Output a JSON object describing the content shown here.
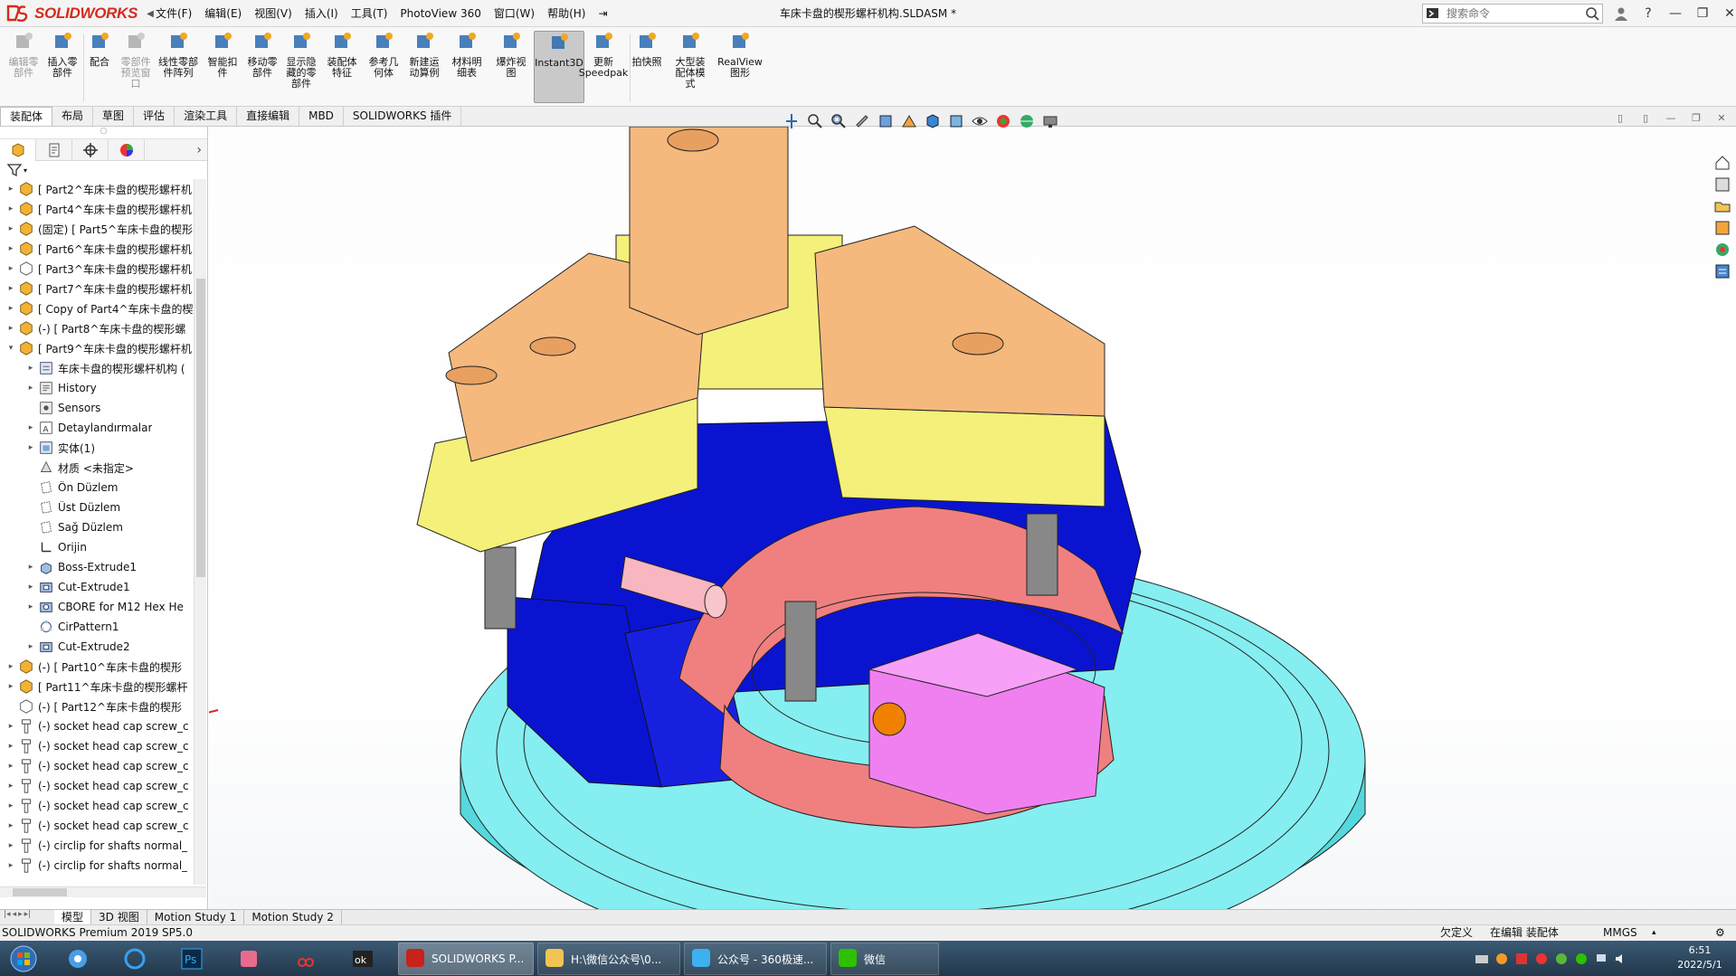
{
  "app": {
    "brand": "SOLIDWORKS",
    "document_title": "车床卡盘的楔形螺杆机构.SLDASM *",
    "menus": [
      "文件(F)",
      "编辑(E)",
      "视图(V)",
      "插入(I)",
      "工具(T)",
      "PhotoView 360",
      "窗口(W)",
      "帮助(H)"
    ],
    "search_placeholder": "搜索命令",
    "help_label": "?"
  },
  "ribbon": [
    {
      "label": "编辑零\n部件",
      "icon": "edit-component-icon",
      "disabled": true
    },
    {
      "label": "插入零\n部件",
      "icon": "insert-component-icon",
      "disabled": false
    },
    {
      "label": "配合",
      "icon": "mate-icon",
      "disabled": false
    },
    {
      "label": "零部件\n预览窗\n口",
      "icon": "component-preview-icon",
      "disabled": true
    },
    {
      "label": "线性零部\n件阵列",
      "icon": "linear-pattern-icon",
      "disabled": false
    },
    {
      "label": "智能扣\n件",
      "icon": "smart-fasteners-icon",
      "disabled": false
    },
    {
      "label": "移动零\n部件",
      "icon": "move-component-icon",
      "disabled": false
    },
    {
      "label": "显示隐\n藏的零\n部件",
      "icon": "show-hidden-icon",
      "disabled": false
    },
    {
      "label": "装配体\n特征",
      "icon": "assembly-features-icon",
      "disabled": false
    },
    {
      "label": "参考几\n何体",
      "icon": "reference-geometry-icon",
      "disabled": false
    },
    {
      "label": "新建运\n动算例",
      "icon": "new-motion-study-icon",
      "disabled": false
    },
    {
      "label": "材料明\n细表",
      "icon": "bom-icon",
      "disabled": false
    },
    {
      "label": "爆炸视\n图",
      "icon": "exploded-view-icon",
      "disabled": false
    },
    {
      "label": "Instant3D",
      "icon": "instant3d-icon",
      "disabled": false,
      "active": true
    },
    {
      "label": "更新\nSpeedpak",
      "icon": "speedpak-icon",
      "disabled": false
    },
    {
      "label": "拍快照",
      "icon": "snapshot-icon",
      "disabled": false
    },
    {
      "label": "大型装\n配体模\n式",
      "icon": "large-assembly-icon",
      "disabled": false
    },
    {
      "label": "RealView\n图形",
      "icon": "realview-icon",
      "disabled": false
    }
  ],
  "command_tabs": [
    "装配体",
    "布局",
    "草图",
    "评估",
    "渲染工具",
    "直接编辑",
    "MBD",
    "SOLIDWORKS 插件"
  ],
  "tree": [
    {
      "label": "[ Part2^车床卡盘的楔形螺杆机",
      "level": 0,
      "expand": "▸",
      "icon": "part-icon"
    },
    {
      "label": "[ Part4^车床卡盘的楔形螺杆机",
      "level": 0,
      "expand": "▸",
      "icon": "part-icon"
    },
    {
      "label": "(固定) [ Part5^车床卡盘的楔形",
      "level": 0,
      "expand": "▸",
      "icon": "part-icon"
    },
    {
      "label": "[ Part6^车床卡盘的楔形螺杆机",
      "level": 0,
      "expand": "▸",
      "icon": "part-icon"
    },
    {
      "label": "[ Part3^车床卡盘的楔形螺杆机",
      "level": 0,
      "expand": "▸",
      "icon": "part-outline-icon"
    },
    {
      "label": "[ Part7^车床卡盘的楔形螺杆机",
      "level": 0,
      "expand": "▸",
      "icon": "part-icon"
    },
    {
      "label": "[ Copy of Part4^车床卡盘的楔",
      "level": 0,
      "expand": "▸",
      "icon": "part-icon"
    },
    {
      "label": "(-) [ Part8^车床卡盘的楔形螺",
      "level": 0,
      "expand": "▸",
      "icon": "part-icon"
    },
    {
      "label": "[ Part9^车床卡盘的楔形螺杆机",
      "level": 0,
      "expand": "▾",
      "icon": "part-icon"
    },
    {
      "label": "车床卡盘的楔形螺杆机构 (",
      "level": 1,
      "expand": "▸",
      "icon": "document-icon"
    },
    {
      "label": "History",
      "level": 1,
      "expand": "▸",
      "icon": "history-icon"
    },
    {
      "label": "Sensors",
      "level": 1,
      "expand": "",
      "icon": "sensors-icon"
    },
    {
      "label": "Detaylandırmalar",
      "level": 1,
      "expand": "▸",
      "icon": "annotations-icon"
    },
    {
      "label": "实体(1)",
      "level": 1,
      "expand": "▸",
      "icon": "solid-bodies-icon"
    },
    {
      "label": "材质 <未指定>",
      "level": 1,
      "expand": "",
      "icon": "material-icon"
    },
    {
      "label": "Ön Düzlem",
      "level": 1,
      "expand": "",
      "icon": "plane-icon"
    },
    {
      "label": "Üst Düzlem",
      "level": 1,
      "expand": "",
      "icon": "plane-icon"
    },
    {
      "label": "Sağ Düzlem",
      "level": 1,
      "expand": "",
      "icon": "plane-icon"
    },
    {
      "label": "Orijin",
      "level": 1,
      "expand": "",
      "icon": "origin-icon"
    },
    {
      "label": "Boss-Extrude1",
      "level": 1,
      "expand": "▸",
      "icon": "extrude-icon"
    },
    {
      "label": "Cut-Extrude1",
      "level": 1,
      "expand": "▸",
      "icon": "cut-extrude-icon"
    },
    {
      "label": "CBORE for M12 Hex He",
      "level": 1,
      "expand": "▸",
      "icon": "hole-icon"
    },
    {
      "label": "CirPattern1",
      "level": 1,
      "expand": "",
      "icon": "circular-pattern-icon"
    },
    {
      "label": "Cut-Extrude2",
      "level": 1,
      "expand": "▸",
      "icon": "cut-extrude-icon"
    },
    {
      "label": "(-) [ Part10^车床卡盘的楔形",
      "level": 0,
      "expand": "▸",
      "icon": "part-icon"
    },
    {
      "label": "[ Part11^车床卡盘的楔形螺杆",
      "level": 0,
      "expand": "▸",
      "icon": "part-icon"
    },
    {
      "label": "(-) [ Part12^车床卡盘的楔形",
      "level": 0,
      "expand": "",
      "icon": "part-outline-icon"
    },
    {
      "label": "(-) socket head cap screw_c",
      "level": 0,
      "expand": "▸",
      "icon": "screw-icon"
    },
    {
      "label": "(-) socket head cap screw_c",
      "level": 0,
      "expand": "▸",
      "icon": "screw-icon"
    },
    {
      "label": "(-) socket head cap screw_c",
      "level": 0,
      "expand": "▸",
      "icon": "screw-icon"
    },
    {
      "label": "(-) socket head cap screw_c",
      "level": 0,
      "expand": "▸",
      "icon": "screw-icon"
    },
    {
      "label": "(-) socket head cap screw_c",
      "level": 0,
      "expand": "▸",
      "icon": "screw-icon"
    },
    {
      "label": "(-) socket head cap screw_c",
      "level": 0,
      "expand": "▸",
      "icon": "screw-icon"
    },
    {
      "label": "(-) circlip for shafts normal_",
      "level": 0,
      "expand": "▸",
      "icon": "screw-icon"
    },
    {
      "label": "(-) circlip for shafts normal_",
      "level": 0,
      "expand": "▸",
      "icon": "screw-icon"
    }
  ],
  "bottom_tabs": [
    "模型",
    "3D 视图",
    "Motion Study 1",
    "Motion Study 2"
  ],
  "status": {
    "product": "SOLIDWORKS Premium 2019 SP5.0",
    "definition": "欠定义",
    "mode": "在编辑 装配体",
    "units": "MMGS"
  },
  "taskbar": {
    "apps": [
      {
        "label": "SOLIDWORKS P...",
        "icon": "solidworks-icon",
        "active": true
      },
      {
        "label": "H:\\微信公众号\\0...",
        "icon": "folder-icon",
        "active": false
      },
      {
        "label": "公众号 - 360极速...",
        "icon": "browser-360-icon",
        "active": false
      },
      {
        "label": "微信",
        "icon": "wechat-icon",
        "active": false
      }
    ],
    "time": "6:51",
    "date": "2022/5/1"
  },
  "colors": {
    "jaw_top": "#f5b97d",
    "jaw_base": "#f4f07a",
    "body_blue": "#0a14d0",
    "plate_cyan": "#7feef0",
    "ring_pink": "#f08080",
    "slider_magenta": "#f080f0"
  }
}
